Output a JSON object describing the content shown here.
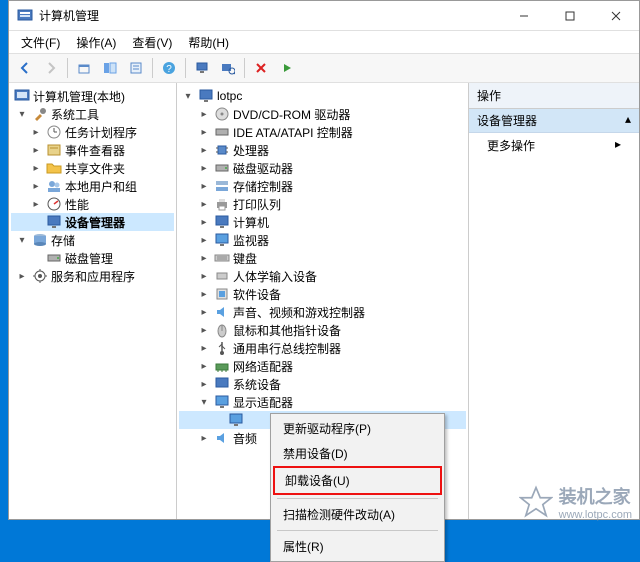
{
  "window": {
    "title": "计算机管理"
  },
  "menubar": {
    "file": "文件(F)",
    "action": "操作(A)",
    "view": "查看(V)",
    "help": "帮助(H)"
  },
  "left_tree": {
    "root": "计算机管理(本地)",
    "systools": "系统工具",
    "task_scheduler": "任务计划程序",
    "event_viewer": "事件查看器",
    "shared_folders": "共享文件夹",
    "local_users": "本地用户和组",
    "performance": "性能",
    "device_manager": "设备管理器",
    "storage": "存储",
    "disk_mgmt": "磁盘管理",
    "services_apps": "服务和应用程序"
  },
  "mid_tree": {
    "root": "lotpc",
    "dvd": "DVD/CD-ROM 驱动器",
    "ide": "IDE ATA/ATAPI 控制器",
    "cpu": "处理器",
    "disk_drives": "磁盘驱动器",
    "storage_ctrl": "存储控制器",
    "print_queue": "打印队列",
    "computer": "计算机",
    "monitor": "监视器",
    "keyboard": "键盘",
    "hid": "人体学输入设备",
    "software_dev": "软件设备",
    "sound": "声音、视频和游戏控制器",
    "mouse": "鼠标和其他指针设备",
    "usb": "通用串行总线控制器",
    "network": "网络适配器",
    "system_dev": "系统设备",
    "display": "显示适配器",
    "display_child": "",
    "audio_partial": "音频"
  },
  "right_pane": {
    "header": "操作",
    "group": "设备管理器",
    "more": "更多操作"
  },
  "context_menu": {
    "update": "更新驱动程序(P)",
    "disable": "禁用设备(D)",
    "uninstall": "卸载设备(U)",
    "scan": "扫描检测硬件改动(A)",
    "props": "属性(R)"
  },
  "watermark": {
    "text": "装机之家",
    "url": "www.lotpc.com"
  }
}
